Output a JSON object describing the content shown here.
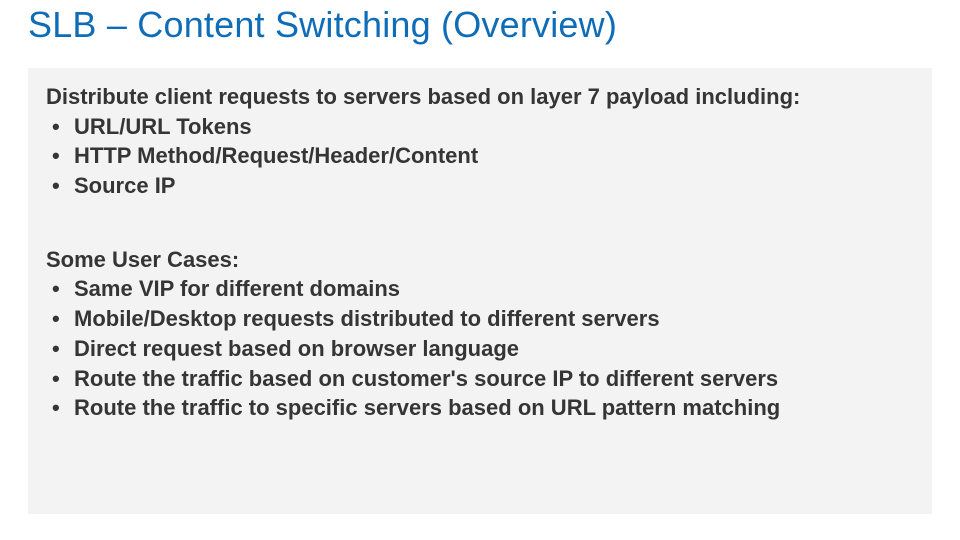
{
  "title": "SLB – Content Switching (Overview)",
  "section1": {
    "intro": "Distribute client requests to servers based on layer 7 payload including:",
    "items": [
      "URL/URL Tokens",
      "HTTP Method/Request/Header/Content",
      "Source IP"
    ]
  },
  "section2": {
    "intro": "Some User Cases:",
    "items": [
      "Same VIP for different domains",
      "Mobile/Desktop requests distributed to different servers",
      "Direct request based on browser language",
      "Route the traffic based on customer's source IP to different servers",
      "Route the traffic to specific servers based on URL pattern matching"
    ]
  }
}
